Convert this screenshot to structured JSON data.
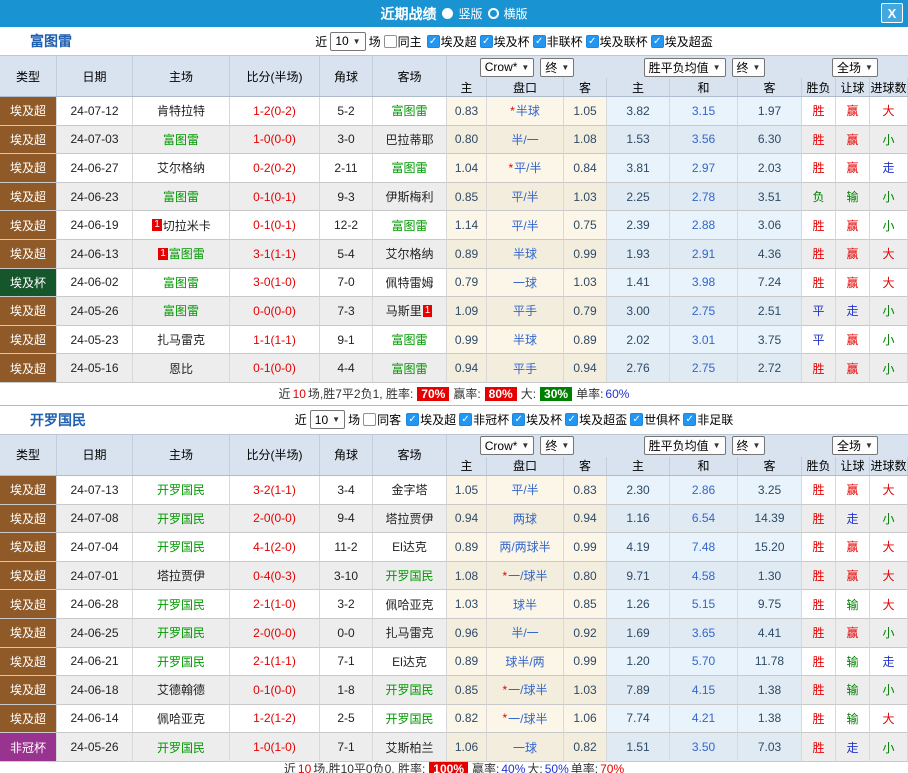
{
  "window": {
    "title": "近期战绩",
    "radios": [
      {
        "label": "竖版",
        "selected": true
      },
      {
        "label": "横版",
        "selected": false
      }
    ],
    "close_label": "X"
  },
  "table_header": {
    "main_columns": [
      "类型",
      "日期",
      "主场",
      "比分(半场)",
      "角球",
      "客场"
    ],
    "sub_columns": [
      "主",
      "盘口",
      "客",
      "主",
      "和",
      "客",
      "胜负",
      "让球",
      "进球数"
    ],
    "selects": {
      "odds_company": "Crow*",
      "odds_time_1": "终",
      "avg_label": "胜平负均值",
      "odds_time_2": "终",
      "scope": "全场"
    }
  },
  "colors": {
    "titlebar_bg": "#1a93d3",
    "team_green": "#009900",
    "score_red": "#e60000",
    "league_bg": {
      "埃及超": "#8f5a28",
      "埃及杯": "#15562b",
      "非冠杯": "#993390"
    },
    "outcome": {
      "胜": "#e60000",
      "平": "#2233cc",
      "负": "#008000",
      "赢": "#e60000",
      "走": "#2233cc",
      "输": "#008000",
      "大": "#e60000",
      "小": "#008000"
    },
    "text": {
      "red": "#e60000",
      "blue": "#2233cc",
      "green": "#008000"
    }
  },
  "sections": [
    {
      "team": "富图雷",
      "filter": {
        "prefix": "近",
        "count": "10",
        "suffix": "场",
        "same_venue": {
          "label": "同主",
          "checked": false
        },
        "leagues": [
          {
            "label": "埃及超",
            "checked": true
          },
          {
            "label": "埃及杯",
            "checked": true
          },
          {
            "label": "非联杯",
            "checked": true
          },
          {
            "label": "埃及联杯",
            "checked": true
          },
          {
            "label": "埃及超盃",
            "checked": true
          }
        ]
      },
      "rows": [
        {
          "league": "埃及超",
          "date": "24-07-12",
          "home": "肯特拉特",
          "homeFocal": false,
          "homeBadge": null,
          "homeBadgePos": null,
          "score": "1-2(0-2)",
          "corner": "5-2",
          "away": "富图雷",
          "awayFocal": true,
          "awayBadge": null,
          "awayBadgePos": null,
          "oddsHome": "0.83",
          "star": true,
          "handicap": "半球",
          "oddsAway": "1.05",
          "avgHome": "3.82",
          "avgDraw": "3.15",
          "avgAway": "1.97",
          "result": "胜",
          "hres": "赢",
          "goals": "大"
        },
        {
          "league": "埃及超",
          "date": "24-07-03",
          "home": "富图雷",
          "homeFocal": true,
          "homeBadge": null,
          "homeBadgePos": null,
          "score": "1-0(0-0)",
          "corner": "3-0",
          "away": "巴拉蒂耶",
          "awayFocal": false,
          "awayBadge": null,
          "awayBadgePos": null,
          "oddsHome": "0.80",
          "star": false,
          "handicap": "半/一",
          "oddsAway": "1.08",
          "avgHome": "1.53",
          "avgDraw": "3.56",
          "avgAway": "6.30",
          "result": "胜",
          "hres": "赢",
          "goals": "小"
        },
        {
          "league": "埃及超",
          "date": "24-06-27",
          "home": "艾尔格纳",
          "homeFocal": false,
          "homeBadge": null,
          "homeBadgePos": null,
          "score": "0-2(0-2)",
          "corner": "2-11",
          "away": "富图雷",
          "awayFocal": true,
          "awayBadge": null,
          "awayBadgePos": null,
          "oddsHome": "1.04",
          "star": true,
          "handicap": "平/半",
          "oddsAway": "0.84",
          "avgHome": "3.81",
          "avgDraw": "2.97",
          "avgAway": "2.03",
          "result": "胜",
          "hres": "赢",
          "goals": "走"
        },
        {
          "league": "埃及超",
          "date": "24-06-23",
          "home": "富图雷",
          "homeFocal": true,
          "homeBadge": null,
          "homeBadgePos": null,
          "score": "0-1(0-1)",
          "corner": "9-3",
          "away": "伊斯梅利",
          "awayFocal": false,
          "awayBadge": null,
          "awayBadgePos": null,
          "oddsHome": "0.85",
          "star": false,
          "handicap": "平/半",
          "oddsAway": "1.03",
          "avgHome": "2.25",
          "avgDraw": "2.78",
          "avgAway": "3.51",
          "result": "负",
          "hres": "输",
          "goals": "小"
        },
        {
          "league": "埃及超",
          "date": "24-06-19",
          "home": "切拉米卡",
          "homeFocal": false,
          "homeBadge": "1",
          "homeBadgePos": "before",
          "score": "0-1(0-1)",
          "corner": "12-2",
          "away": "富图雷",
          "awayFocal": true,
          "awayBadge": null,
          "awayBadgePos": null,
          "oddsHome": "1.14",
          "star": false,
          "handicap": "平/半",
          "oddsAway": "0.75",
          "avgHome": "2.39",
          "avgDraw": "2.88",
          "avgAway": "3.06",
          "result": "胜",
          "hres": "赢",
          "goals": "小"
        },
        {
          "league": "埃及超",
          "date": "24-06-13",
          "home": "富图雷",
          "homeFocal": true,
          "homeBadge": "1",
          "homeBadgePos": "before",
          "score": "3-1(1-1)",
          "corner": "5-4",
          "away": "艾尔格纳",
          "awayFocal": false,
          "awayBadge": null,
          "awayBadgePos": null,
          "oddsHome": "0.89",
          "star": false,
          "handicap": "半球",
          "oddsAway": "0.99",
          "avgHome": "1.93",
          "avgDraw": "2.91",
          "avgAway": "4.36",
          "result": "胜",
          "hres": "赢",
          "goals": "大"
        },
        {
          "league": "埃及杯",
          "date": "24-06-02",
          "home": "富图雷",
          "homeFocal": true,
          "homeBadge": null,
          "homeBadgePos": null,
          "score": "3-0(1-0)",
          "corner": "7-0",
          "away": "佩特雷姆",
          "awayFocal": false,
          "awayBadge": null,
          "awayBadgePos": null,
          "oddsHome": "0.79",
          "star": false,
          "handicap": "一球",
          "oddsAway": "1.03",
          "avgHome": "1.41",
          "avgDraw": "3.98",
          "avgAway": "7.24",
          "result": "胜",
          "hres": "赢",
          "goals": "大"
        },
        {
          "league": "埃及超",
          "date": "24-05-26",
          "home": "富图雷",
          "homeFocal": true,
          "homeBadge": null,
          "homeBadgePos": null,
          "score": "0-0(0-0)",
          "corner": "7-3",
          "away": "马斯里",
          "awayFocal": false,
          "awayBadge": "1",
          "awayBadgePos": "after",
          "oddsHome": "1.09",
          "star": false,
          "handicap": "平手",
          "oddsAway": "0.79",
          "avgHome": "3.00",
          "avgDraw": "2.75",
          "avgAway": "2.51",
          "result": "平",
          "hres": "走",
          "goals": "小"
        },
        {
          "league": "埃及超",
          "date": "24-05-23",
          "home": "扎马雷克",
          "homeFocal": false,
          "homeBadge": null,
          "homeBadgePos": null,
          "score": "1-1(1-1)",
          "corner": "9-1",
          "away": "富图雷",
          "awayFocal": true,
          "awayBadge": null,
          "awayBadgePos": null,
          "oddsHome": "0.99",
          "star": false,
          "handicap": "半球",
          "oddsAway": "0.89",
          "avgHome": "2.02",
          "avgDraw": "3.01",
          "avgAway": "3.75",
          "result": "平",
          "hres": "赢",
          "goals": "小"
        },
        {
          "league": "埃及超",
          "date": "24-05-16",
          "home": "恩比",
          "homeFocal": false,
          "homeBadge": null,
          "homeBadgePos": null,
          "score": "0-1(0-0)",
          "corner": "4-4",
          "away": "富图雷",
          "awayFocal": true,
          "awayBadge": null,
          "awayBadgePos": null,
          "oddsHome": "0.94",
          "star": false,
          "handicap": "平手",
          "oddsAway": "0.94",
          "avgHome": "2.76",
          "avgDraw": "2.75",
          "avgAway": "2.72",
          "result": "胜",
          "hres": "赢",
          "goals": "小"
        }
      ],
      "summary": [
        {
          "t": "近"
        },
        {
          "t": "10",
          "c": "red"
        },
        {
          "t": "场,胜7平2负1, 胜率:"
        },
        {
          "t": "70%",
          "b": "red"
        },
        {
          "t": "赢率:"
        },
        {
          "t": "80%",
          "b": "red"
        },
        {
          "t": "大:"
        },
        {
          "t": "30%",
          "b": "green"
        },
        {
          "t": "单率:"
        },
        {
          "t": "60%",
          "c": "blue"
        }
      ]
    },
    {
      "team": "开罗国民",
      "filter": {
        "prefix": "近",
        "count": "10",
        "suffix": "场",
        "same_venue": {
          "label": "同客",
          "checked": false
        },
        "leagues": [
          {
            "label": "埃及超",
            "checked": true
          },
          {
            "label": "非冠杯",
            "checked": true
          },
          {
            "label": "埃及杯",
            "checked": true
          },
          {
            "label": "埃及超盃",
            "checked": true
          },
          {
            "label": "世俱杯",
            "checked": true
          },
          {
            "label": "非足联",
            "checked": true
          }
        ]
      },
      "rows": [
        {
          "league": "埃及超",
          "date": "24-07-13",
          "home": "开罗国民",
          "homeFocal": true,
          "homeBadge": null,
          "homeBadgePos": null,
          "score": "3-2(1-1)",
          "corner": "3-4",
          "away": "金字塔",
          "awayFocal": false,
          "awayBadge": null,
          "awayBadgePos": null,
          "oddsHome": "1.05",
          "star": false,
          "handicap": "平/半",
          "oddsAway": "0.83",
          "avgHome": "2.30",
          "avgDraw": "2.86",
          "avgAway": "3.25",
          "result": "胜",
          "hres": "赢",
          "goals": "大"
        },
        {
          "league": "埃及超",
          "date": "24-07-08",
          "home": "开罗国民",
          "homeFocal": true,
          "homeBadge": null,
          "homeBadgePos": null,
          "score": "2-0(0-0)",
          "corner": "9-4",
          "away": "塔拉贾伊",
          "awayFocal": false,
          "awayBadge": null,
          "awayBadgePos": null,
          "oddsHome": "0.94",
          "star": false,
          "handicap": "两球",
          "oddsAway": "0.94",
          "avgHome": "1.16",
          "avgDraw": "6.54",
          "avgAway": "14.39",
          "result": "胜",
          "hres": "走",
          "goals": "小"
        },
        {
          "league": "埃及超",
          "date": "24-07-04",
          "home": "开罗国民",
          "homeFocal": true,
          "homeBadge": null,
          "homeBadgePos": null,
          "score": "4-1(2-0)",
          "corner": "11-2",
          "away": "El达克",
          "awayFocal": false,
          "awayBadge": null,
          "awayBadgePos": null,
          "oddsHome": "0.89",
          "star": false,
          "handicap": "两/两球半",
          "oddsAway": "0.99",
          "avgHome": "4.19",
          "avgDraw": "7.48",
          "avgAway": "15.20",
          "result": "胜",
          "hres": "赢",
          "goals": "大"
        },
        {
          "league": "埃及超",
          "date": "24-07-01",
          "home": "塔拉贾伊",
          "homeFocal": false,
          "homeBadge": null,
          "homeBadgePos": null,
          "score": "0-4(0-3)",
          "corner": "3-10",
          "away": "开罗国民",
          "awayFocal": true,
          "awayBadge": null,
          "awayBadgePos": null,
          "oddsHome": "1.08",
          "star": true,
          "handicap": "一/球半",
          "oddsAway": "0.80",
          "avgHome": "9.71",
          "avgDraw": "4.58",
          "avgAway": "1.30",
          "result": "胜",
          "hres": "赢",
          "goals": "大"
        },
        {
          "league": "埃及超",
          "date": "24-06-28",
          "home": "开罗国民",
          "homeFocal": true,
          "homeBadge": null,
          "homeBadgePos": null,
          "score": "2-1(1-0)",
          "corner": "3-2",
          "away": "佩哈亚克",
          "awayFocal": false,
          "awayBadge": null,
          "awayBadgePos": null,
          "oddsHome": "1.03",
          "star": false,
          "handicap": "球半",
          "oddsAway": "0.85",
          "avgHome": "1.26",
          "avgDraw": "5.15",
          "avgAway": "9.75",
          "result": "胜",
          "hres": "输",
          "goals": "大"
        },
        {
          "league": "埃及超",
          "date": "24-06-25",
          "home": "开罗国民",
          "homeFocal": true,
          "homeBadge": null,
          "homeBadgePos": null,
          "score": "2-0(0-0)",
          "corner": "0-0",
          "away": "扎马雷克",
          "awayFocal": false,
          "awayBadge": null,
          "awayBadgePos": null,
          "oddsHome": "0.96",
          "star": false,
          "handicap": "半/一",
          "oddsAway": "0.92",
          "avgHome": "1.69",
          "avgDraw": "3.65",
          "avgAway": "4.41",
          "result": "胜",
          "hres": "赢",
          "goals": "小"
        },
        {
          "league": "埃及超",
          "date": "24-06-21",
          "home": "开罗国民",
          "homeFocal": true,
          "homeBadge": null,
          "homeBadgePos": null,
          "score": "2-1(1-1)",
          "corner": "7-1",
          "away": "El达克",
          "awayFocal": false,
          "awayBadge": null,
          "awayBadgePos": null,
          "oddsHome": "0.89",
          "star": false,
          "handicap": "球半/两",
          "oddsAway": "0.99",
          "avgHome": "1.20",
          "avgDraw": "5.70",
          "avgAway": "11.78",
          "result": "胜",
          "hres": "输",
          "goals": "走"
        },
        {
          "league": "埃及超",
          "date": "24-06-18",
          "home": "艾德翰德",
          "homeFocal": false,
          "homeBadge": null,
          "homeBadgePos": null,
          "score": "0-1(0-0)",
          "corner": "1-8",
          "away": "开罗国民",
          "awayFocal": true,
          "awayBadge": null,
          "awayBadgePos": null,
          "oddsHome": "0.85",
          "star": true,
          "handicap": "一/球半",
          "oddsAway": "1.03",
          "avgHome": "7.89",
          "avgDraw": "4.15",
          "avgAway": "1.38",
          "result": "胜",
          "hres": "输",
          "goals": "小"
        },
        {
          "league": "埃及超",
          "date": "24-06-14",
          "home": "佩哈亚克",
          "homeFocal": false,
          "homeBadge": null,
          "homeBadgePos": null,
          "score": "1-2(1-2)",
          "corner": "2-5",
          "away": "开罗国民",
          "awayFocal": true,
          "awayBadge": null,
          "awayBadgePos": null,
          "oddsHome": "0.82",
          "star": true,
          "handicap": "一/球半",
          "oddsAway": "1.06",
          "avgHome": "7.74",
          "avgDraw": "4.21",
          "avgAway": "1.38",
          "result": "胜",
          "hres": "输",
          "goals": "大"
        },
        {
          "league": "非冠杯",
          "date": "24-05-26",
          "home": "开罗国民",
          "homeFocal": true,
          "homeBadge": null,
          "homeBadgePos": null,
          "score": "1-0(1-0)",
          "corner": "7-1",
          "away": "艾斯柏兰",
          "awayFocal": false,
          "awayBadge": null,
          "awayBadgePos": null,
          "oddsHome": "1.06",
          "star": false,
          "handicap": "一球",
          "oddsAway": "0.82",
          "avgHome": "1.51",
          "avgDraw": "3.50",
          "avgAway": "7.03",
          "result": "胜",
          "hres": "走",
          "goals": "小"
        }
      ],
      "summary": [
        {
          "t": "近"
        },
        {
          "t": "10",
          "c": "red"
        },
        {
          "t": "场,胜10平0负0, 胜率:"
        },
        {
          "t": "100%",
          "b": "red"
        },
        {
          "t": "赢率:"
        },
        {
          "t": "40%",
          "c": "blue"
        },
        {
          "t": "大:"
        },
        {
          "t": "50%",
          "c": "blue"
        },
        {
          "t": "单率:"
        },
        {
          "t": "70%",
          "c": "red"
        }
      ]
    }
  ]
}
